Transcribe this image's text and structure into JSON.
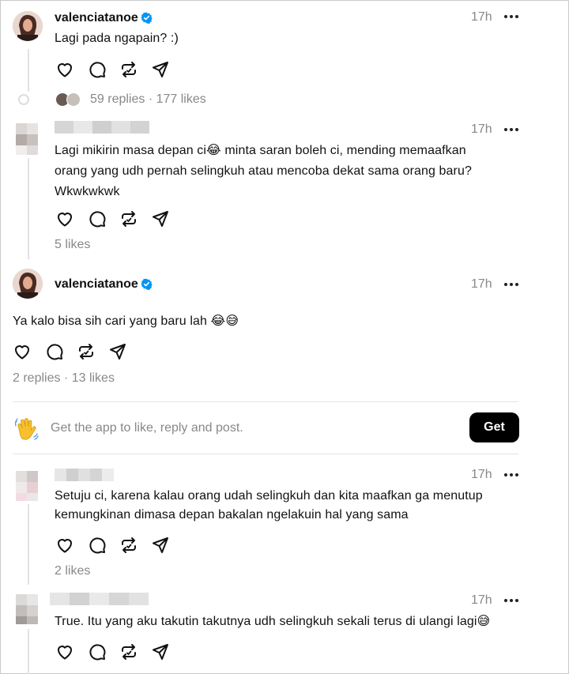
{
  "posts": [
    {
      "username": "valenciatanoe",
      "time": "17h",
      "text": "Lagi pada ngapain? :)",
      "stats": "59 replies · 177 likes"
    },
    {
      "username": "",
      "time": "17h",
      "text_line1": "Lagi mikirin masa depan ci😂 minta saran boleh ci, mending memaafkan",
      "text_line2": "orang yang udh pernah selingkuh atau mencoba dekat sama orang baru?",
      "text_line3": "Wkwkwkwk",
      "stats": "5 likes"
    },
    {
      "username": "valenciatanoe",
      "time": "17h",
      "text": "Ya kalo bisa sih cari yang baru lah 😂😅",
      "stats": "2 replies · 13 likes"
    },
    {
      "username": "",
      "time": "17h",
      "text_line1": "Setuju ci, karena kalau orang udah selingkuh dan kita maafkan ga menutup",
      "text_line2": "kemungkinan dimasa depan bakalan ngelakuin hal yang sama",
      "stats": "2 likes"
    },
    {
      "username": "",
      "time": "17h",
      "text": "True. Itu yang aku takutin takutnya udh selingkuh sekali terus di ulangi lagi😅"
    }
  ],
  "cta": {
    "text": "Get the app to like, reply and post.",
    "button": "Get",
    "icon": "waving-hand-icon"
  },
  "icons": [
    "heart-icon",
    "comment-icon",
    "repost-icon",
    "share-icon",
    "more-icon",
    "verified-icon"
  ],
  "colors": {
    "verified": "#0095f6",
    "muted": "#888888",
    "button": "#000000"
  }
}
